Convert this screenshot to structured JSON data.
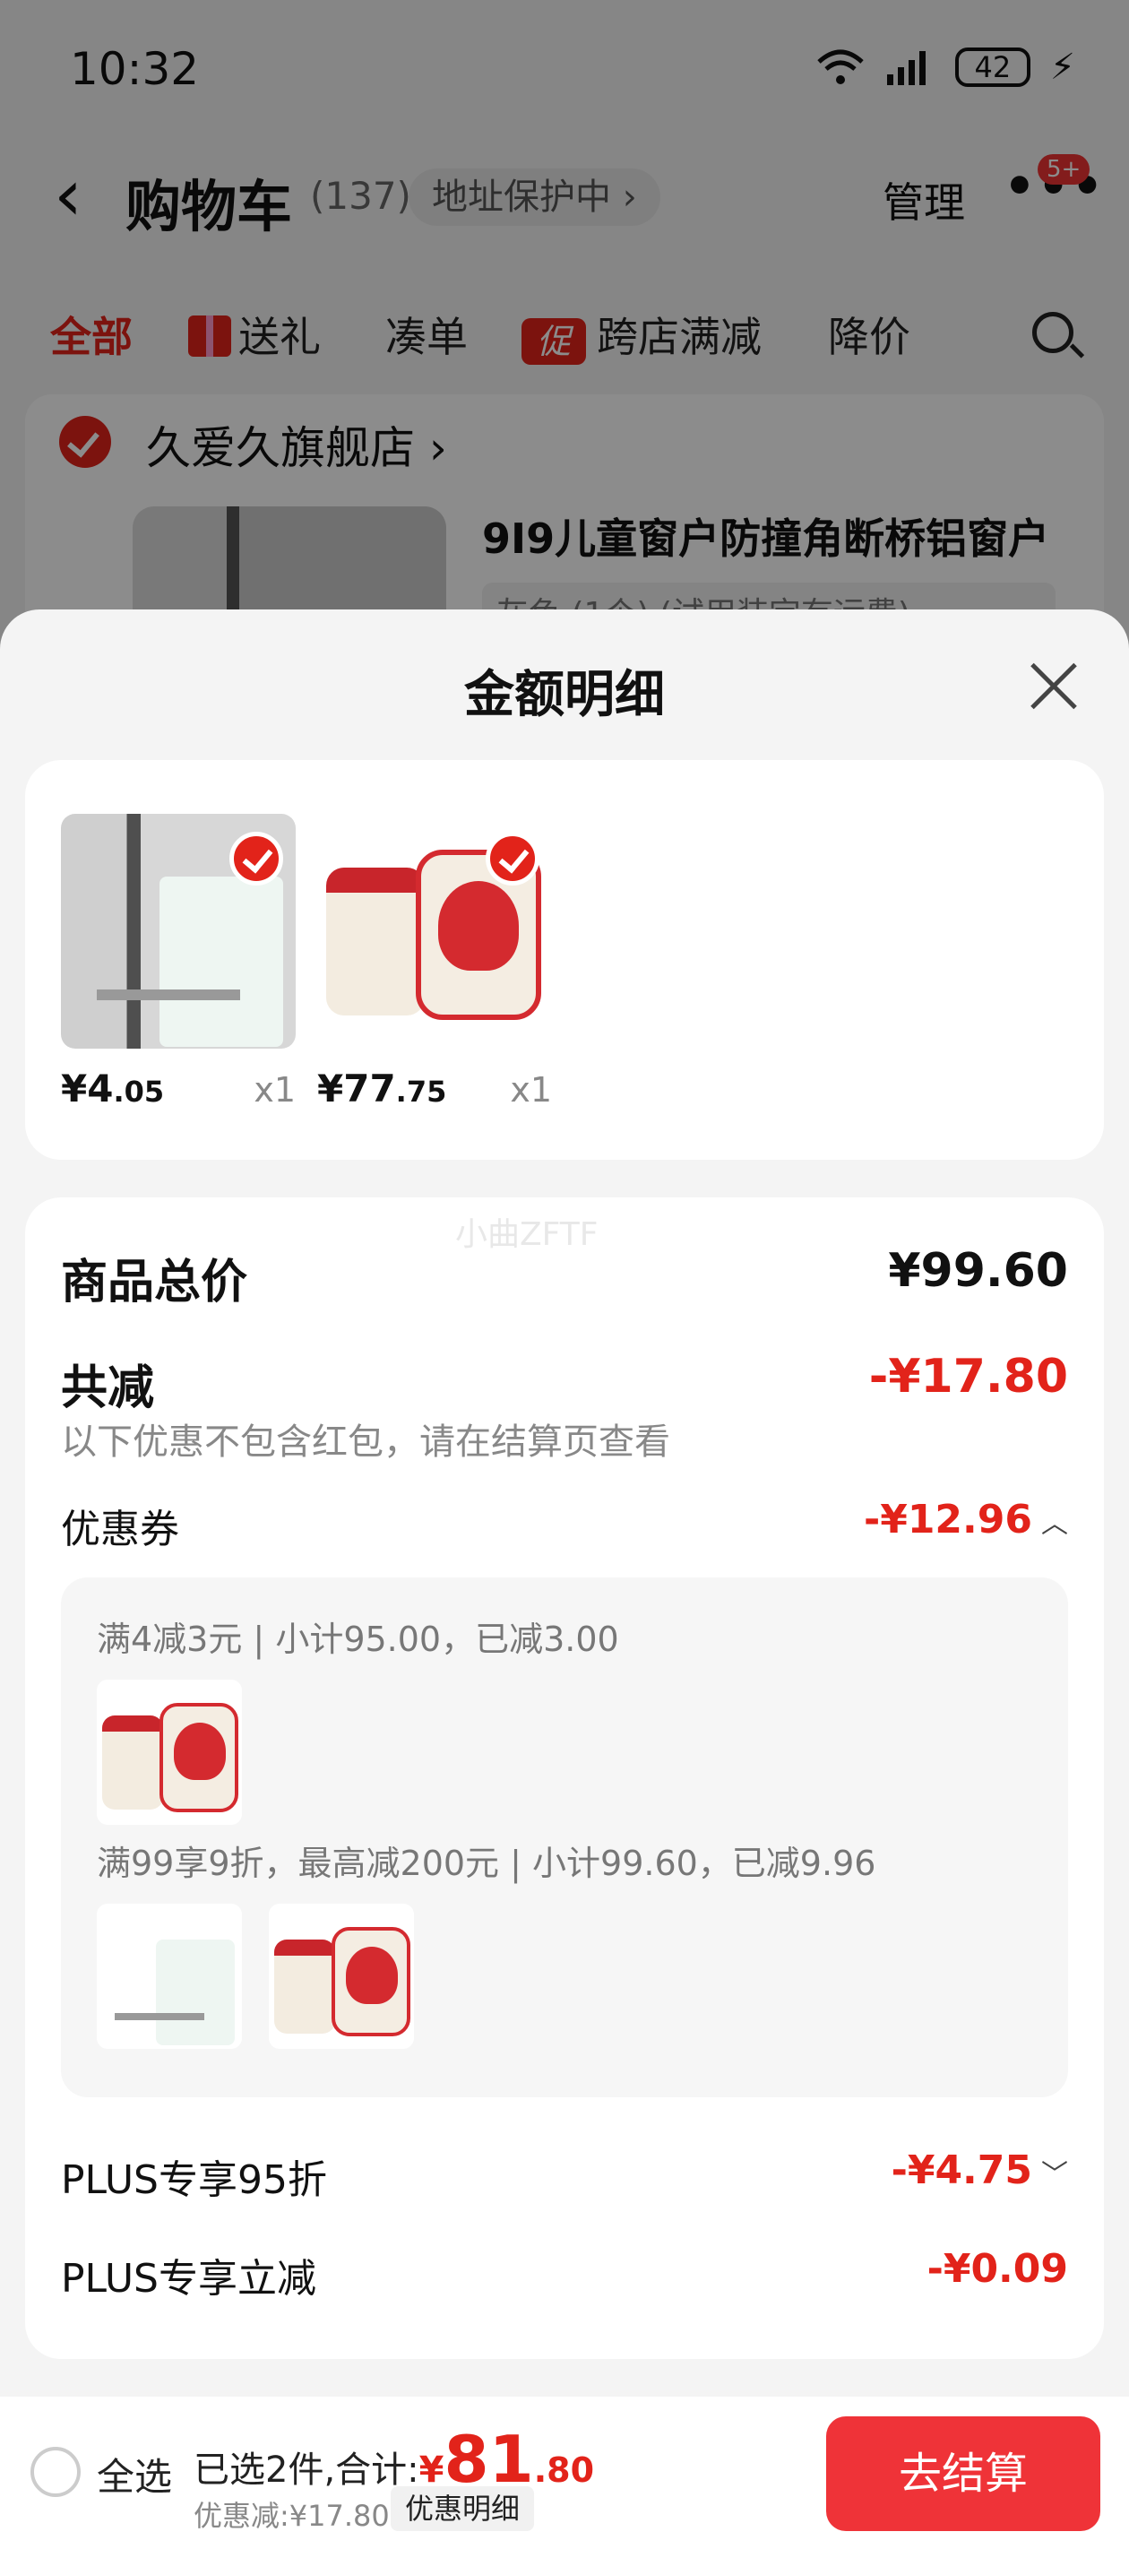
{
  "status": {
    "time": "10:32",
    "battery": "42"
  },
  "header": {
    "title": "购物车",
    "count": "(137)",
    "address_pill": "地址保护中 ›",
    "manage": "管理",
    "more_badge": "5+"
  },
  "tabs": [
    "全部",
    "送礼",
    "凑单",
    "跨店满减",
    "降价"
  ],
  "promo_tag": "促",
  "store": {
    "name": "久爱久旗舰店 ›",
    "product_title": "9I9儿童窗户防撞角断桥铝窗户",
    "product_sub": "灰色 (1个) (试用装定有运费)"
  },
  "sheet": {
    "title": "金额明细",
    "products": [
      {
        "price_int": "¥4",
        "price_dec": ".05",
        "qty": "x1"
      },
      {
        "price_int": "¥77",
        "price_dec": ".75",
        "qty": "x1"
      }
    ],
    "watermark": "小曲ZFTF",
    "total_label": "商品总价",
    "total_value": "¥99.60",
    "reduce_label": "共减",
    "reduce_value": "-¥17.80",
    "reduce_hint": "以下优惠不包含红包，请在结算页查看",
    "coupon_label": "优惠券",
    "coupon_value": "-¥12.96",
    "coupon_lines": [
      "满4减3元 | 小计95.00，已减3.00",
      "满99享9折，最高减200元 | 小计99.60，已减9.96"
    ],
    "plus95_label": "PLUS专享95折",
    "plus95_value": "-¥4.75",
    "plusoff_label": "PLUS专享立减",
    "plusoff_value": "-¥0.09"
  },
  "bottom": {
    "select_all": "全选",
    "summary_prefix": "已选2件,合计:",
    "sum_currency": "¥",
    "sum_int": "81",
    "sum_dec": ".80",
    "discount": "优惠减:¥17.80",
    "discount_btn": "优惠明细",
    "checkout": "去结算"
  },
  "colors": {
    "accent": "#e2231a",
    "checkout": "#ef3338"
  },
  "icons": [
    "back-arrow-icon",
    "wifi-icon",
    "signal-icon",
    "battery-icon",
    "search-icon",
    "close-icon",
    "check-icon",
    "chevron-up-icon",
    "chevron-down-icon"
  ]
}
